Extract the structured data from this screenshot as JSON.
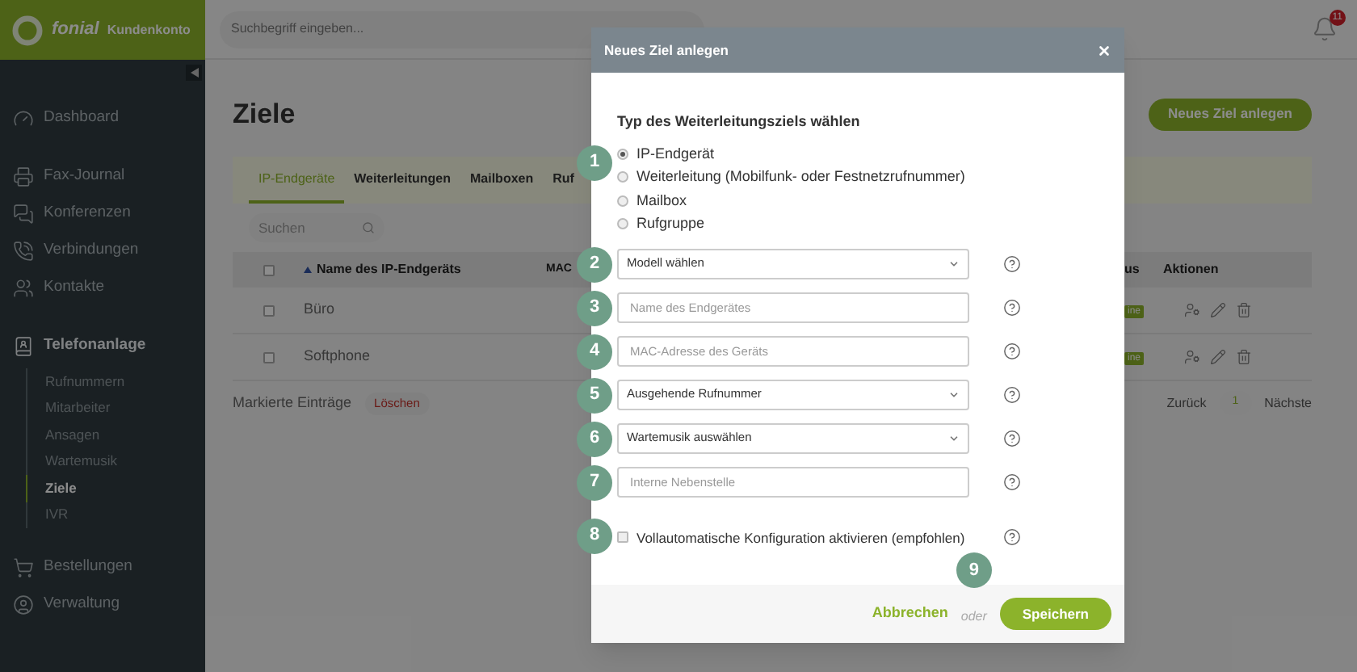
{
  "header": {
    "logo_text": "fonial",
    "logo_subtitle": "Kundenkonto",
    "search_placeholder": "Suchbegriff eingeben...",
    "notification_count": "11"
  },
  "sidebar": {
    "sections": [
      {
        "items": [
          {
            "label": "Dashboard",
            "kind": "dashboard"
          }
        ]
      },
      {
        "items": [
          {
            "label": "Fax-Journal",
            "kind": "fax"
          },
          {
            "label": "Konferenzen",
            "kind": "conference"
          },
          {
            "label": "Verbindungen",
            "kind": "calls"
          },
          {
            "label": "Kontakte",
            "kind": "contacts"
          }
        ]
      },
      {
        "items": [
          {
            "label": "Telefonanlage",
            "kind": "pbx",
            "expanded": true,
            "children": [
              {
                "label": "Rufnummern",
                "selected": false
              },
              {
                "label": "Mitarbeiter",
                "selected": false
              },
              {
                "label": "Ansagen",
                "selected": false
              },
              {
                "label": "Wartemusik",
                "selected": false
              },
              {
                "label": "Ziele",
                "selected": true
              },
              {
                "label": "IVR",
                "selected": false
              }
            ]
          }
        ]
      },
      {
        "items": [
          {
            "label": "Bestellungen",
            "kind": "orders"
          },
          {
            "label": "Verwaltung",
            "kind": "admin"
          }
        ]
      }
    ]
  },
  "page": {
    "title": "Ziele",
    "new_button": "Neues Ziel anlegen",
    "tabs": [
      {
        "label": "IP-Endgeräte",
        "selected": true
      },
      {
        "label": "Weiterleitungen",
        "selected": false
      },
      {
        "label": "Mailboxen",
        "selected": false
      },
      {
        "label": "Ruf",
        "selected": false
      }
    ],
    "search_placeholder": "Suchen",
    "table": {
      "select_all_checked": false,
      "columns": [
        "Name des IP-Endgeräts",
        "MAC",
        "us",
        "Aktionen"
      ],
      "rows": [
        {
          "name": "Büro",
          "checked": false,
          "status": "ine"
        },
        {
          "name": "Softphone",
          "checked": false,
          "status": "ine"
        }
      ]
    },
    "bulk_label": "Markierte Einträge",
    "bulk_delete": "Löschen",
    "pagination": {
      "previous": "Zurück",
      "page": "1",
      "next": "Nächste"
    }
  },
  "modal": {
    "title": "Neues Ziel anlegen",
    "type_heading": "Typ des Weiterleitungsziels wählen",
    "type_step": "1",
    "type_options": [
      {
        "label": "IP-Endgerät",
        "selected": true
      },
      {
        "label": "Weiterleitung (Mobilfunk- oder Festnetzrufnummer)",
        "selected": false
      },
      {
        "label": "Mailbox",
        "selected": false
      },
      {
        "label": "Rufgruppe",
        "selected": false
      }
    ],
    "fields": [
      {
        "kind": "select",
        "value": "Modell wählen",
        "step": "2"
      },
      {
        "kind": "input",
        "placeholder": "Name des Endgerätes",
        "step": "3"
      },
      {
        "kind": "input",
        "placeholder": "MAC-Adresse des Geräts",
        "step": "4"
      },
      {
        "kind": "select",
        "value": "Ausgehende Rufnummer",
        "step": "5"
      },
      {
        "kind": "select",
        "value": "Wartemusik auswählen",
        "step": "6"
      },
      {
        "kind": "input",
        "placeholder": "Interne Nebenstelle",
        "step": "7"
      }
    ],
    "auto_config": {
      "label": "Vollautomatische Konfiguration aktivieren (empfohlen)",
      "checked": false,
      "step": "8"
    },
    "cancel": "Abbrechen",
    "or": "oder",
    "save": "Speichern",
    "footer_step": "9"
  }
}
